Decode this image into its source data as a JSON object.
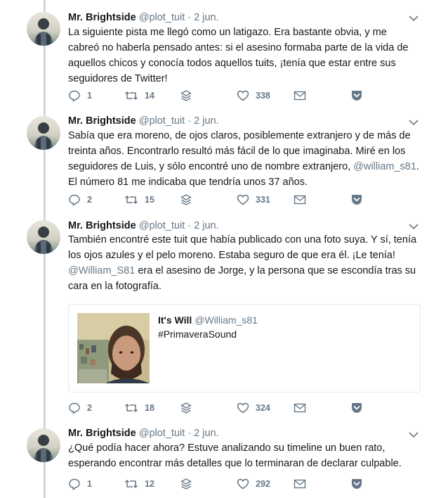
{
  "tweets": [
    {
      "name": "Mr. Brightside",
      "handle": "@plot_tuit",
      "sep": "·",
      "time": "2 jun.",
      "text_parts": [
        "La siguiente pista me llegó como un latigazo. Era bastante obvia, y me cabreó no haberla pensado antes: si el asesino formaba parte de la vida de aquellos chicos y conocía todos aquellos tuits, ¡tenía que estar entre sus seguidores de Twitter!"
      ],
      "replies": "1",
      "retweets": "14",
      "likes": "338"
    },
    {
      "name": "Mr. Brightside",
      "handle": "@plot_tuit",
      "sep": "·",
      "time": "2 jun.",
      "text_parts": [
        "Sabía que era moreno, de ojos claros, posiblemente extranjero y de más de treinta años. Encontrarlo resultó más fácil de lo que imaginaba. Miré en los seguidores de Luis, y sólo encontré uno de nombre extranjero, ",
        "@william_s81",
        ". El número 81 me indicaba que tendría unos 37 años."
      ],
      "replies": "2",
      "retweets": "15",
      "likes": "331"
    },
    {
      "name": "Mr. Brightside",
      "handle": "@plot_tuit",
      "sep": "·",
      "time": "2 jun.",
      "text_parts": [
        "También encontré este tuit que había publicado con una foto suya. Y sí, tenía los ojos azules y el pelo moreno. Estaba seguro de que era él. ¡Le tenía! ",
        "@William_S81",
        " era el asesino de Jorge, y la persona que se escondía tras su cara en la fotografía."
      ],
      "replies": "2",
      "retweets": "18",
      "likes": "324"
    },
    {
      "name": "Mr. Brightside",
      "handle": "@plot_tuit",
      "sep": "·",
      "time": "2 jun.",
      "text_parts": [
        "¿Qué podía hacer ahora? Estuve analizando su timeline un buen rato, esperando encontrar más detalles que lo terminaran de declarar culpable."
      ],
      "replies": "1",
      "retweets": "12",
      "likes": "292"
    }
  ],
  "quoted": {
    "name": "It's Will",
    "handle": "@William_s81",
    "text": "#PrimaveraSound"
  },
  "icons": {
    "reply": "reply-icon",
    "retweet": "retweet-icon",
    "stack": "layers-icon",
    "like": "heart-icon",
    "dm": "envelope-icon",
    "pocket": "pocket-save-icon",
    "caret": "chevron-down-icon"
  },
  "colors": {
    "muted": "#657786",
    "text": "#14171a",
    "line": "#ccd6dd",
    "pocket": "#657786"
  }
}
